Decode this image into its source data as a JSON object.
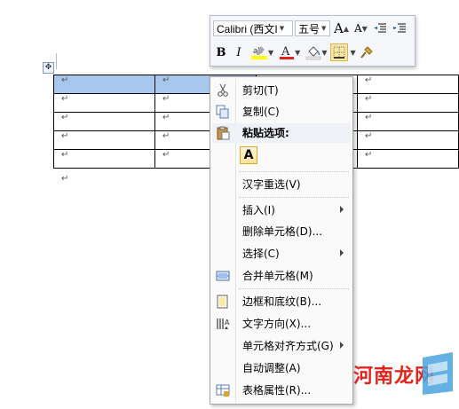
{
  "toolbar": {
    "font_name": "Calibri (西文I",
    "font_size": "五号",
    "grow_font": "A",
    "shrink_font": "A",
    "bold": "B",
    "italic": "I",
    "font_color_letter": "A"
  },
  "table": {
    "paragraph_mark": "↵",
    "rows": [
      [
        "↵",
        "↵",
        "",
        "↵"
      ],
      [
        "↵",
        "↵",
        "",
        "↵"
      ],
      [
        "↵",
        "↵",
        "",
        "↵"
      ],
      [
        "↵",
        "↵",
        "",
        "↵"
      ],
      [
        "↵",
        "↵",
        "",
        "↵"
      ]
    ]
  },
  "context_menu": {
    "items": [
      {
        "label": "剪切(T)",
        "icon": "scissors-icon"
      },
      {
        "label": "复制(C)",
        "icon": "copy-icon"
      },
      {
        "label": "粘贴选项:",
        "icon": "clipboard-icon"
      },
      {
        "label": "A",
        "icon": "paste-keep-text-icon"
      },
      {
        "label": "汉字重选(V)",
        "icon": ""
      },
      {
        "label": "插入(I)",
        "icon": "",
        "submenu": true
      },
      {
        "label": "删除单元格(D)...",
        "icon": ""
      },
      {
        "label": "选择(C)",
        "icon": "",
        "submenu": true
      },
      {
        "label": "合并单元格(M)",
        "icon": "merge-cells-icon"
      },
      {
        "label": "边框和底纹(B)...",
        "icon": "borders-icon"
      },
      {
        "label": "文字方向(X)...",
        "icon": "text-direction-icon"
      },
      {
        "label": "单元格对齐方式(G)",
        "icon": "",
        "submenu": true
      },
      {
        "label": "自动调整(A)",
        "icon": ""
      },
      {
        "label": "表格属性(R)...",
        "icon": "table-properties-icon"
      }
    ]
  },
  "watermark": {
    "text": "河南龙网"
  },
  "colors": {
    "selection": "#a8c7ec",
    "font_color": "#e3221b",
    "highlight": "#ffff00"
  }
}
